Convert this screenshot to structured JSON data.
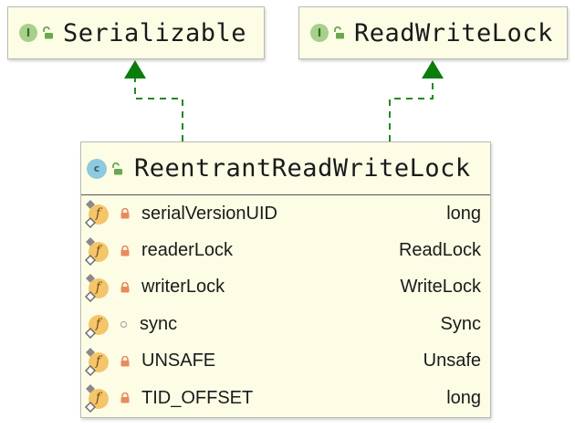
{
  "diagram": {
    "interfaces": [
      {
        "kind_letter": "I",
        "name": "Serializable",
        "icon": "interface-icon",
        "visibility": "public"
      },
      {
        "kind_letter": "I",
        "name": "ReadWriteLock",
        "icon": "interface-icon",
        "visibility": "public"
      }
    ],
    "main_class": {
      "kind_letter": "c",
      "name": "ReentrantReadWriteLock",
      "icon": "class-icon",
      "visibility": "public",
      "fields": [
        {
          "letter": "f",
          "name": "serialVersionUID",
          "type": "long",
          "visibility": "private",
          "icon": "field-icon"
        },
        {
          "letter": "f",
          "name": "readerLock",
          "type": "ReadLock",
          "visibility": "private",
          "icon": "field-icon"
        },
        {
          "letter": "f",
          "name": "writerLock",
          "type": "WriteLock",
          "visibility": "private",
          "icon": "field-icon"
        },
        {
          "letter": "f",
          "name": "sync",
          "type": "Sync",
          "visibility": "package-private",
          "icon": "field-icon"
        },
        {
          "letter": "f",
          "name": "UNSAFE",
          "type": "Unsafe",
          "visibility": "private",
          "icon": "field-icon"
        },
        {
          "letter": "f",
          "name": "TID_OFFSET",
          "type": "long",
          "visibility": "private",
          "icon": "field-icon"
        }
      ]
    },
    "relations": [
      {
        "type": "implements",
        "from": "ReentrantReadWriteLock",
        "to": "Serializable"
      },
      {
        "type": "implements",
        "from": "ReentrantReadWriteLock",
        "to": "ReadWriteLock"
      }
    ],
    "colors": {
      "box_fill": "#fdfde6",
      "box_border": "#b9b9b9",
      "relation_line": "#1f8a1f",
      "arrow_head": "#0a7d0a",
      "interface_badge": "#a8d08d",
      "class_badge": "#8fc9de",
      "field_badge": "#f4c56a",
      "private_lock": "#e98a5b",
      "public_lock": "#6aa84f"
    }
  }
}
